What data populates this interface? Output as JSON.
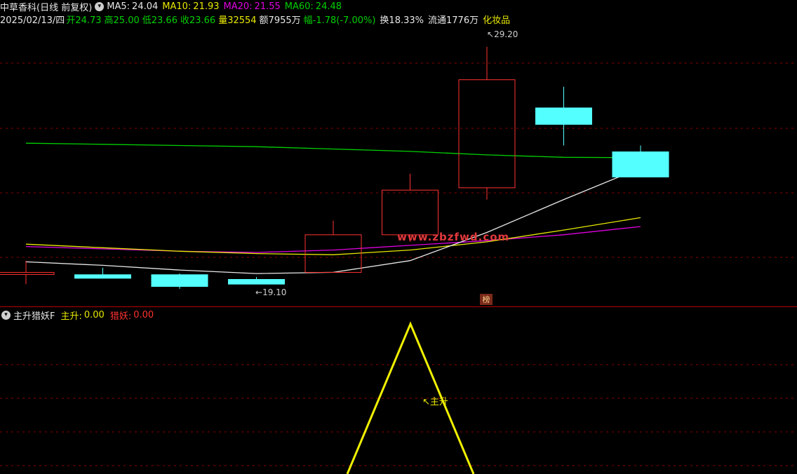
{
  "header": {
    "stock_title": "中草香科(日线 前复权)",
    "ma_btn_icon": "chevron-down-icon",
    "ma5": {
      "label": "MA5:",
      "value": "24.04",
      "color": "#e8e8e8"
    },
    "ma10": {
      "label": "MA10:",
      "value": "21.93",
      "color": "#e8e800"
    },
    "ma20": {
      "label": "MA20:",
      "value": "21.55",
      "color": "#e000e0"
    },
    "ma60": {
      "label": "MA60:",
      "value": "24.48",
      "color": "#00d000"
    },
    "date": "2025/02/13/四",
    "open": "开24.73",
    "high": "高25.00",
    "low": "低23.66",
    "close": "收23.66",
    "volume": "量32554",
    "amount": "额7955万",
    "change": "幅-1.78(-7.00%)",
    "turnover": "换18.33%",
    "float": "流通1776万",
    "sector": "化妆品"
  },
  "price_annotations": {
    "high_label": "29.20",
    "low_label": "19.10"
  },
  "badge": "榜",
  "watermark": "www.zbzfwd.com",
  "indicator": {
    "name": "主升猎妖F",
    "zhusheng_label": "主升:",
    "zhusheng_value": "0.00",
    "lieyao_label": "猎妖:",
    "lieyao_value": "0.00",
    "peak_label": "主升"
  },
  "colors": {
    "background": "#000000",
    "up": "#ff3232",
    "down": "#54ffff",
    "grid": "#8b0000",
    "indicator_line": "#f0f000"
  },
  "chart_data": {
    "type": "candlestick",
    "candles": [
      {
        "open": 19.6,
        "high": 20.1,
        "low": 19.1,
        "close": 19.6
      },
      {
        "open": 19.5,
        "high": 19.8,
        "low": 19.35,
        "close": 19.35
      },
      {
        "open": 19.5,
        "high": 19.55,
        "low": 18.9,
        "close": 19.0
      },
      {
        "open": 19.3,
        "high": 19.4,
        "low": 19.1,
        "close": 19.1
      },
      {
        "open": 19.6,
        "high": 21.8,
        "low": 19.6,
        "close": 21.2
      },
      {
        "open": 21.2,
        "high": 23.8,
        "low": 20.9,
        "close": 23.1
      },
      {
        "open": 23.2,
        "high": 29.2,
        "low": 22.7,
        "close": 27.8
      },
      {
        "open": 26.6,
        "high": 27.5,
        "low": 25.0,
        "close": 25.9
      },
      {
        "open": 24.73,
        "high": 25.0,
        "low": 23.66,
        "close": 23.66
      }
    ],
    "ma5": [
      20.05,
      19.9,
      19.7,
      19.55,
      19.6,
      20.1,
      21.3,
      22.7,
      24.04
    ],
    "ma10": [
      20.8,
      20.65,
      20.5,
      20.4,
      20.35,
      20.55,
      20.9,
      21.4,
      21.93
    ],
    "ma20": [
      20.7,
      20.6,
      20.5,
      20.45,
      20.55,
      20.75,
      20.95,
      21.2,
      21.55
    ],
    "ma60": [
      25.1,
      25.05,
      25.0,
      24.95,
      24.85,
      24.75,
      24.6,
      24.5,
      24.48
    ],
    "ylim": [
      18.3,
      30.0
    ],
    "indicator_zhusheng": [
      0,
      0,
      0,
      0,
      0,
      0,
      1,
      0,
      0
    ]
  }
}
